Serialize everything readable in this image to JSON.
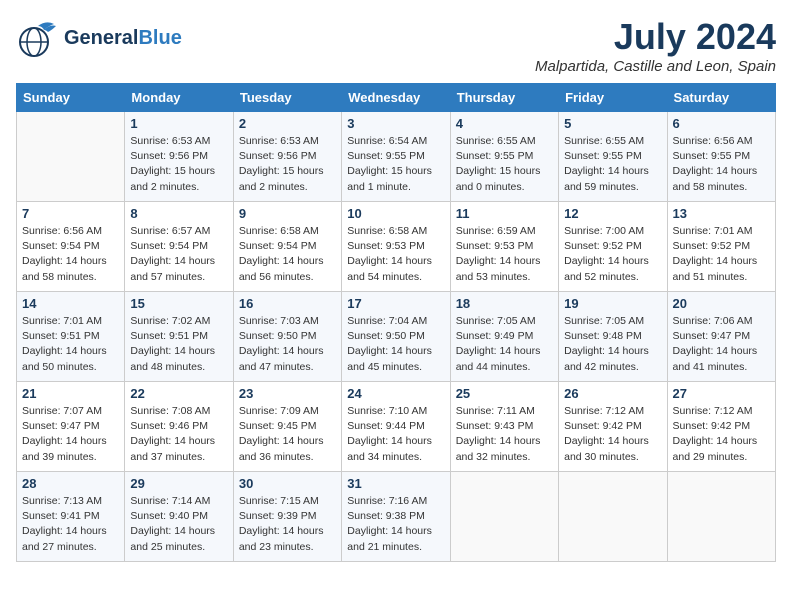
{
  "header": {
    "logo_line1": "General",
    "logo_line2": "Blue",
    "month": "July 2024",
    "location": "Malpartida, Castille and Leon, Spain"
  },
  "weekdays": [
    "Sunday",
    "Monday",
    "Tuesday",
    "Wednesday",
    "Thursday",
    "Friday",
    "Saturday"
  ],
  "weeks": [
    [
      {
        "day": "",
        "info": ""
      },
      {
        "day": "1",
        "info": "Sunrise: 6:53 AM\nSunset: 9:56 PM\nDaylight: 15 hours\nand 2 minutes."
      },
      {
        "day": "2",
        "info": "Sunrise: 6:53 AM\nSunset: 9:56 PM\nDaylight: 15 hours\nand 2 minutes."
      },
      {
        "day": "3",
        "info": "Sunrise: 6:54 AM\nSunset: 9:55 PM\nDaylight: 15 hours\nand 1 minute."
      },
      {
        "day": "4",
        "info": "Sunrise: 6:55 AM\nSunset: 9:55 PM\nDaylight: 15 hours\nand 0 minutes."
      },
      {
        "day": "5",
        "info": "Sunrise: 6:55 AM\nSunset: 9:55 PM\nDaylight: 14 hours\nand 59 minutes."
      },
      {
        "day": "6",
        "info": "Sunrise: 6:56 AM\nSunset: 9:55 PM\nDaylight: 14 hours\nand 58 minutes."
      }
    ],
    [
      {
        "day": "7",
        "info": "Sunrise: 6:56 AM\nSunset: 9:54 PM\nDaylight: 14 hours\nand 58 minutes."
      },
      {
        "day": "8",
        "info": "Sunrise: 6:57 AM\nSunset: 9:54 PM\nDaylight: 14 hours\nand 57 minutes."
      },
      {
        "day": "9",
        "info": "Sunrise: 6:58 AM\nSunset: 9:54 PM\nDaylight: 14 hours\nand 56 minutes."
      },
      {
        "day": "10",
        "info": "Sunrise: 6:58 AM\nSunset: 9:53 PM\nDaylight: 14 hours\nand 54 minutes."
      },
      {
        "day": "11",
        "info": "Sunrise: 6:59 AM\nSunset: 9:53 PM\nDaylight: 14 hours\nand 53 minutes."
      },
      {
        "day": "12",
        "info": "Sunrise: 7:00 AM\nSunset: 9:52 PM\nDaylight: 14 hours\nand 52 minutes."
      },
      {
        "day": "13",
        "info": "Sunrise: 7:01 AM\nSunset: 9:52 PM\nDaylight: 14 hours\nand 51 minutes."
      }
    ],
    [
      {
        "day": "14",
        "info": "Sunrise: 7:01 AM\nSunset: 9:51 PM\nDaylight: 14 hours\nand 50 minutes."
      },
      {
        "day": "15",
        "info": "Sunrise: 7:02 AM\nSunset: 9:51 PM\nDaylight: 14 hours\nand 48 minutes."
      },
      {
        "day": "16",
        "info": "Sunrise: 7:03 AM\nSunset: 9:50 PM\nDaylight: 14 hours\nand 47 minutes."
      },
      {
        "day": "17",
        "info": "Sunrise: 7:04 AM\nSunset: 9:50 PM\nDaylight: 14 hours\nand 45 minutes."
      },
      {
        "day": "18",
        "info": "Sunrise: 7:05 AM\nSunset: 9:49 PM\nDaylight: 14 hours\nand 44 minutes."
      },
      {
        "day": "19",
        "info": "Sunrise: 7:05 AM\nSunset: 9:48 PM\nDaylight: 14 hours\nand 42 minutes."
      },
      {
        "day": "20",
        "info": "Sunrise: 7:06 AM\nSunset: 9:47 PM\nDaylight: 14 hours\nand 41 minutes."
      }
    ],
    [
      {
        "day": "21",
        "info": "Sunrise: 7:07 AM\nSunset: 9:47 PM\nDaylight: 14 hours\nand 39 minutes."
      },
      {
        "day": "22",
        "info": "Sunrise: 7:08 AM\nSunset: 9:46 PM\nDaylight: 14 hours\nand 37 minutes."
      },
      {
        "day": "23",
        "info": "Sunrise: 7:09 AM\nSunset: 9:45 PM\nDaylight: 14 hours\nand 36 minutes."
      },
      {
        "day": "24",
        "info": "Sunrise: 7:10 AM\nSunset: 9:44 PM\nDaylight: 14 hours\nand 34 minutes."
      },
      {
        "day": "25",
        "info": "Sunrise: 7:11 AM\nSunset: 9:43 PM\nDaylight: 14 hours\nand 32 minutes."
      },
      {
        "day": "26",
        "info": "Sunrise: 7:12 AM\nSunset: 9:42 PM\nDaylight: 14 hours\nand 30 minutes."
      },
      {
        "day": "27",
        "info": "Sunrise: 7:12 AM\nSunset: 9:42 PM\nDaylight: 14 hours\nand 29 minutes."
      }
    ],
    [
      {
        "day": "28",
        "info": "Sunrise: 7:13 AM\nSunset: 9:41 PM\nDaylight: 14 hours\nand 27 minutes."
      },
      {
        "day": "29",
        "info": "Sunrise: 7:14 AM\nSunset: 9:40 PM\nDaylight: 14 hours\nand 25 minutes."
      },
      {
        "day": "30",
        "info": "Sunrise: 7:15 AM\nSunset: 9:39 PM\nDaylight: 14 hours\nand 23 minutes."
      },
      {
        "day": "31",
        "info": "Sunrise: 7:16 AM\nSunset: 9:38 PM\nDaylight: 14 hours\nand 21 minutes."
      },
      {
        "day": "",
        "info": ""
      },
      {
        "day": "",
        "info": ""
      },
      {
        "day": "",
        "info": ""
      }
    ]
  ]
}
